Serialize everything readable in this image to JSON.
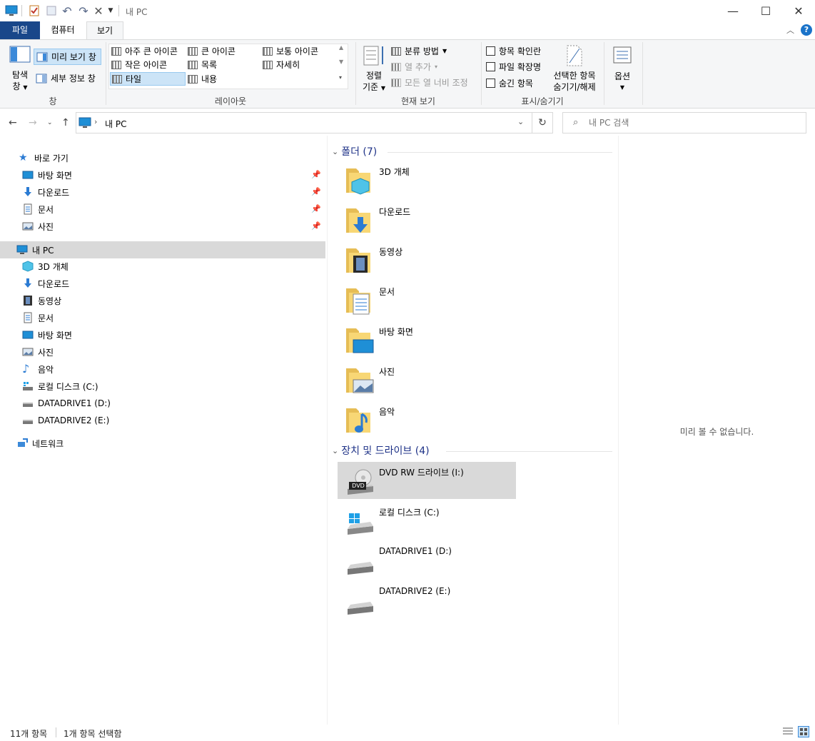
{
  "window": {
    "title": "내 PC"
  },
  "tabs": [
    {
      "label": "파일"
    },
    {
      "label": "컴퓨터"
    },
    {
      "label": "보기"
    }
  ],
  "ribbon": {
    "pane": {
      "nav_label_1": "탐색",
      "nav_label_2": "창",
      "preview": "미리 보기 창",
      "details": "세부 정보 창",
      "group": "창"
    },
    "layout": {
      "items": [
        "아주 큰 아이콘",
        "큰 아이콘",
        "보통 아이콘",
        "작은 아이콘",
        "목록",
        "자세히",
        "타일",
        "내용"
      ],
      "selected": "타일",
      "group": "레이아웃"
    },
    "current_view": {
      "sort_1": "정렬",
      "sort_2": "기준",
      "group_by": "분류 방법",
      "add_column": "열 추가",
      "fit_columns": "모든 열 너비 조정",
      "group": "현재 보기"
    },
    "show_hide": {
      "checkboxes": "항목 확인란",
      "extensions": "파일 확장명",
      "hidden": "숨긴 항목",
      "hide_sel_1": "선택한 항목",
      "hide_sel_2": "숨기기/해제",
      "group": "표시/숨기기"
    },
    "options": {
      "label": "옵션"
    }
  },
  "address": {
    "path": "내 PC",
    "search_placeholder": "내 PC 검색"
  },
  "nav": {
    "quick_access": "바로 가기",
    "quick_items": [
      "바탕 화면",
      "다운로드",
      "문서",
      "사진"
    ],
    "this_pc": "내 PC",
    "pc_items": [
      "3D 개체",
      "다운로드",
      "동영상",
      "문서",
      "바탕 화면",
      "사진",
      "음악",
      "로컬 디스크 (C:)",
      "DATADRIVE1 (D:)",
      "DATADRIVE2 (E:)"
    ],
    "network": "네트워크"
  },
  "content": {
    "folders_header": "폴더 (7)",
    "folders": [
      "3D 개체",
      "다운로드",
      "동영상",
      "문서",
      "바탕 화면",
      "사진",
      "음악"
    ],
    "drives_header": "장치 및 드라이브 (4)",
    "drives": [
      "DVD RW 드라이브 (I:)",
      "로컬 디스크 (C:)",
      "DATADRIVE1 (D:)",
      "DATADRIVE2 (E:)"
    ],
    "dvd_badge": "DVD"
  },
  "preview": {
    "message": "미리 볼 수 없습니다."
  },
  "status": {
    "count": "11개 항목",
    "selected": "1개 항목 선택함"
  },
  "colors": {
    "file_tab": "#19478a",
    "selection": "#d9d9d9",
    "header_text": "#1e3287",
    "folder": "#f8d775"
  }
}
